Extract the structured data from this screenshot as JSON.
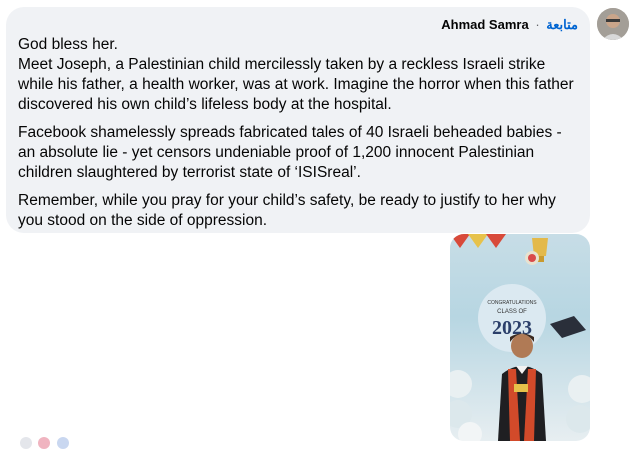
{
  "comment": {
    "author": "Ahmad Samra",
    "separator": "·",
    "follow_label": "متابعة",
    "paragraphs": [
      "God bless her.\nMeet Joseph, a Palestinian child mercilessly taken by a reckless Israeli strike while his father, a health worker, was at work. Imagine the horror when this father discovered his own child’s lifeless body at the hospital.",
      "Facebook shamelessly spreads fabricated tales of 40 Israeli beheaded babies - an absolute lie - yet censors undeniable proof of 1,200 innocent Palestinian children slaughtered by terrorist state of ‘ISISreal’.",
      "Remember, while you pray for your child’s safety, be ready to justify to her why you stood on the side of oppression."
    ]
  },
  "photo": {
    "banner_line1": "CONGRATULATIONS",
    "banner_line2": "CLASS OF",
    "banner_year": "2023"
  },
  "colors": {
    "bubble": "#f0f2f5",
    "link": "#0064d1"
  }
}
